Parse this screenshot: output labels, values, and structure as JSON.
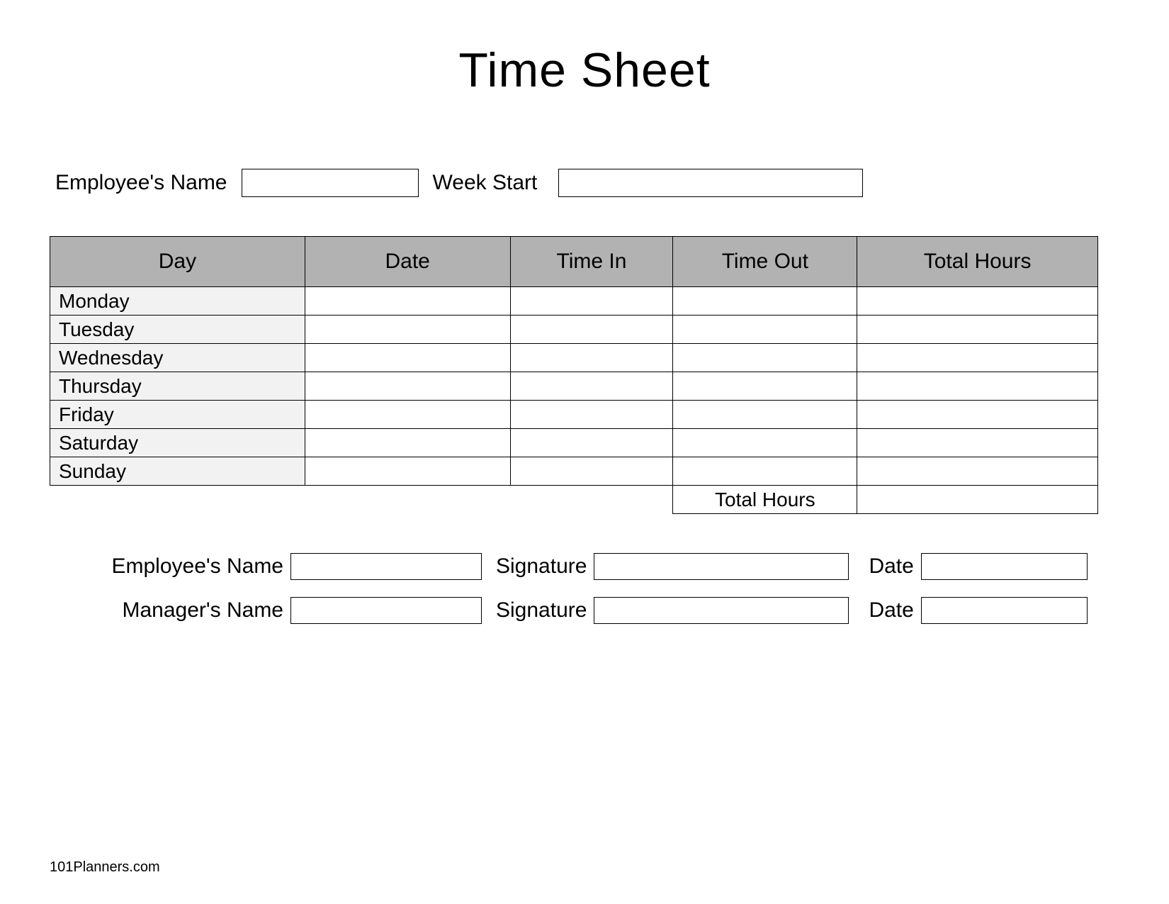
{
  "title": "Time Sheet",
  "top": {
    "employee_label": "Employee's Name",
    "employee_value": "",
    "week_start_label": "Week Start",
    "week_start_value": ""
  },
  "table": {
    "headers": {
      "day": "Day",
      "date": "Date",
      "time_in": "Time In",
      "time_out": "Time Out",
      "total_hours": "Total Hours"
    },
    "rows": [
      {
        "day": "Monday",
        "date": "",
        "time_in": "",
        "time_out": "",
        "total": ""
      },
      {
        "day": "Tuesday",
        "date": "",
        "time_in": "",
        "time_out": "",
        "total": ""
      },
      {
        "day": "Wednesday",
        "date": "",
        "time_in": "",
        "time_out": "",
        "total": ""
      },
      {
        "day": "Thursday",
        "date": "",
        "time_in": "",
        "time_out": "",
        "total": ""
      },
      {
        "day": "Friday",
        "date": "",
        "time_in": "",
        "time_out": "",
        "total": ""
      },
      {
        "day": "Saturday",
        "date": "",
        "time_in": "",
        "time_out": "",
        "total": ""
      },
      {
        "day": "Sunday",
        "date": "",
        "time_in": "",
        "time_out": "",
        "total": ""
      }
    ],
    "footer": {
      "total_hours_label": "Total Hours",
      "total_hours_value": ""
    }
  },
  "signoff": {
    "employee_name_label": "Employee's Name",
    "employee_name_value": "",
    "employee_sig_label": "Signature",
    "employee_sig_value": "",
    "employee_date_label": "Date",
    "employee_date_value": "",
    "manager_name_label": "Manager's Name",
    "manager_name_value": "",
    "manager_sig_label": "Signature",
    "manager_sig_value": "",
    "manager_date_label": "Date",
    "manager_date_value": ""
  },
  "footer_brand": "101Planners.com"
}
